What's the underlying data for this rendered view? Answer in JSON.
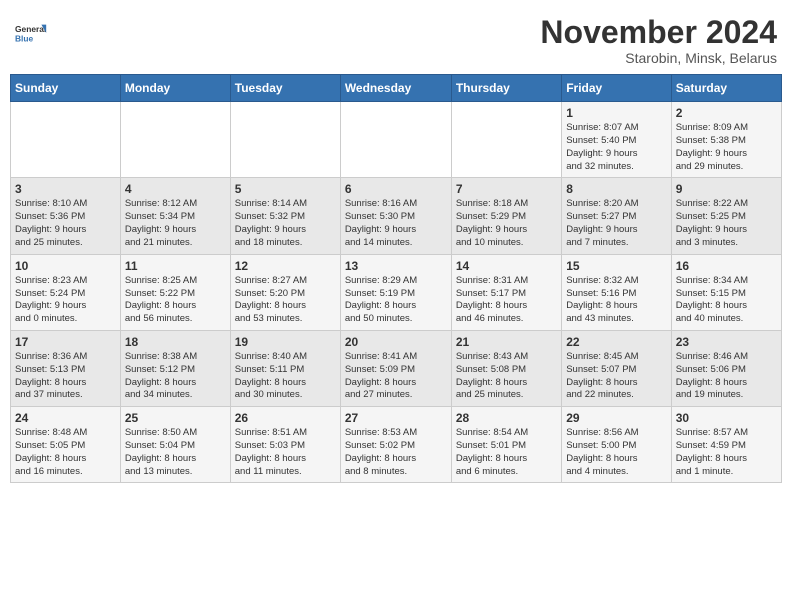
{
  "header": {
    "logo_line1": "General",
    "logo_line2": "Blue",
    "month": "November 2024",
    "location": "Starobin, Minsk, Belarus"
  },
  "weekdays": [
    "Sunday",
    "Monday",
    "Tuesday",
    "Wednesday",
    "Thursday",
    "Friday",
    "Saturday"
  ],
  "weeks": [
    [
      {
        "day": "",
        "info": ""
      },
      {
        "day": "",
        "info": ""
      },
      {
        "day": "",
        "info": ""
      },
      {
        "day": "",
        "info": ""
      },
      {
        "day": "",
        "info": ""
      },
      {
        "day": "1",
        "info": "Sunrise: 8:07 AM\nSunset: 5:40 PM\nDaylight: 9 hours\nand 32 minutes."
      },
      {
        "day": "2",
        "info": "Sunrise: 8:09 AM\nSunset: 5:38 PM\nDaylight: 9 hours\nand 29 minutes."
      }
    ],
    [
      {
        "day": "3",
        "info": "Sunrise: 8:10 AM\nSunset: 5:36 PM\nDaylight: 9 hours\nand 25 minutes."
      },
      {
        "day": "4",
        "info": "Sunrise: 8:12 AM\nSunset: 5:34 PM\nDaylight: 9 hours\nand 21 minutes."
      },
      {
        "day": "5",
        "info": "Sunrise: 8:14 AM\nSunset: 5:32 PM\nDaylight: 9 hours\nand 18 minutes."
      },
      {
        "day": "6",
        "info": "Sunrise: 8:16 AM\nSunset: 5:30 PM\nDaylight: 9 hours\nand 14 minutes."
      },
      {
        "day": "7",
        "info": "Sunrise: 8:18 AM\nSunset: 5:29 PM\nDaylight: 9 hours\nand 10 minutes."
      },
      {
        "day": "8",
        "info": "Sunrise: 8:20 AM\nSunset: 5:27 PM\nDaylight: 9 hours\nand 7 minutes."
      },
      {
        "day": "9",
        "info": "Sunrise: 8:22 AM\nSunset: 5:25 PM\nDaylight: 9 hours\nand 3 minutes."
      }
    ],
    [
      {
        "day": "10",
        "info": "Sunrise: 8:23 AM\nSunset: 5:24 PM\nDaylight: 9 hours\nand 0 minutes."
      },
      {
        "day": "11",
        "info": "Sunrise: 8:25 AM\nSunset: 5:22 PM\nDaylight: 8 hours\nand 56 minutes."
      },
      {
        "day": "12",
        "info": "Sunrise: 8:27 AM\nSunset: 5:20 PM\nDaylight: 8 hours\nand 53 minutes."
      },
      {
        "day": "13",
        "info": "Sunrise: 8:29 AM\nSunset: 5:19 PM\nDaylight: 8 hours\nand 50 minutes."
      },
      {
        "day": "14",
        "info": "Sunrise: 8:31 AM\nSunset: 5:17 PM\nDaylight: 8 hours\nand 46 minutes."
      },
      {
        "day": "15",
        "info": "Sunrise: 8:32 AM\nSunset: 5:16 PM\nDaylight: 8 hours\nand 43 minutes."
      },
      {
        "day": "16",
        "info": "Sunrise: 8:34 AM\nSunset: 5:15 PM\nDaylight: 8 hours\nand 40 minutes."
      }
    ],
    [
      {
        "day": "17",
        "info": "Sunrise: 8:36 AM\nSunset: 5:13 PM\nDaylight: 8 hours\nand 37 minutes."
      },
      {
        "day": "18",
        "info": "Sunrise: 8:38 AM\nSunset: 5:12 PM\nDaylight: 8 hours\nand 34 minutes."
      },
      {
        "day": "19",
        "info": "Sunrise: 8:40 AM\nSunset: 5:11 PM\nDaylight: 8 hours\nand 30 minutes."
      },
      {
        "day": "20",
        "info": "Sunrise: 8:41 AM\nSunset: 5:09 PM\nDaylight: 8 hours\nand 27 minutes."
      },
      {
        "day": "21",
        "info": "Sunrise: 8:43 AM\nSunset: 5:08 PM\nDaylight: 8 hours\nand 25 minutes."
      },
      {
        "day": "22",
        "info": "Sunrise: 8:45 AM\nSunset: 5:07 PM\nDaylight: 8 hours\nand 22 minutes."
      },
      {
        "day": "23",
        "info": "Sunrise: 8:46 AM\nSunset: 5:06 PM\nDaylight: 8 hours\nand 19 minutes."
      }
    ],
    [
      {
        "day": "24",
        "info": "Sunrise: 8:48 AM\nSunset: 5:05 PM\nDaylight: 8 hours\nand 16 minutes."
      },
      {
        "day": "25",
        "info": "Sunrise: 8:50 AM\nSunset: 5:04 PM\nDaylight: 8 hours\nand 13 minutes."
      },
      {
        "day": "26",
        "info": "Sunrise: 8:51 AM\nSunset: 5:03 PM\nDaylight: 8 hours\nand 11 minutes."
      },
      {
        "day": "27",
        "info": "Sunrise: 8:53 AM\nSunset: 5:02 PM\nDaylight: 8 hours\nand 8 minutes."
      },
      {
        "day": "28",
        "info": "Sunrise: 8:54 AM\nSunset: 5:01 PM\nDaylight: 8 hours\nand 6 minutes."
      },
      {
        "day": "29",
        "info": "Sunrise: 8:56 AM\nSunset: 5:00 PM\nDaylight: 8 hours\nand 4 minutes."
      },
      {
        "day": "30",
        "info": "Sunrise: 8:57 AM\nSunset: 4:59 PM\nDaylight: 8 hours\nand 1 minute."
      }
    ]
  ]
}
